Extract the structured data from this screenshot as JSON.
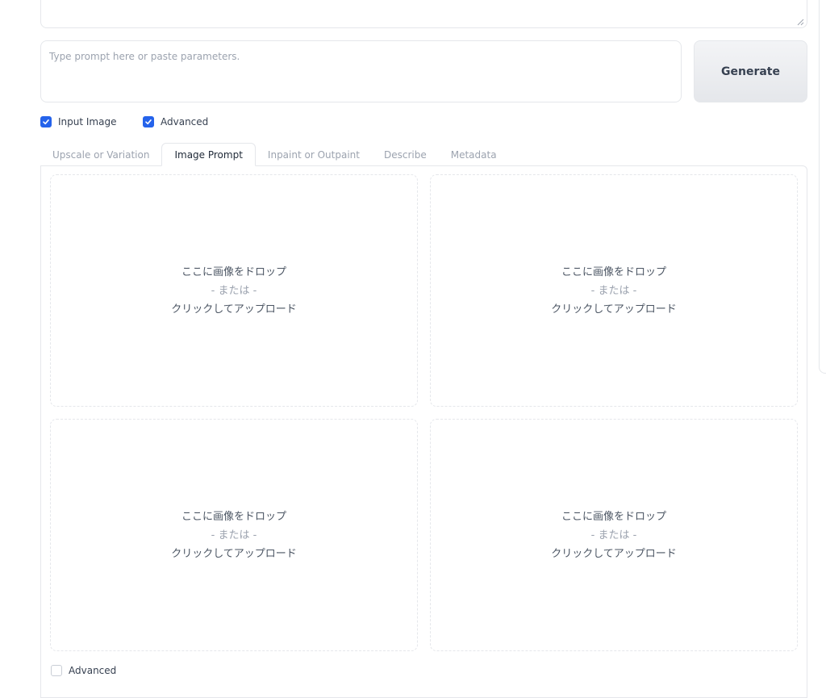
{
  "prompt": {
    "placeholder": "Type prompt here or paste parameters.",
    "generate_label": "Generate"
  },
  "options": {
    "input_image_label": "Input Image",
    "input_image_checked": true,
    "advanced_label": "Advanced",
    "advanced_checked": true
  },
  "tabs": [
    {
      "label": "Upscale or Variation",
      "active": false
    },
    {
      "label": "Image Prompt",
      "active": true
    },
    {
      "label": "Inpaint or Outpaint",
      "active": false
    },
    {
      "label": "Describe",
      "active": false
    },
    {
      "label": "Metadata",
      "active": false
    }
  ],
  "dropzone": {
    "line1": "ここに画像をドロップ",
    "line2": "- または -",
    "line3": "クリックしてアップロード"
  },
  "image_prompt": {
    "advanced_label": "Advanced",
    "advanced_checked": false
  },
  "colors": {
    "accent": "#2563eb",
    "border": "#e5e7eb",
    "muted_text": "#9ca3af"
  }
}
